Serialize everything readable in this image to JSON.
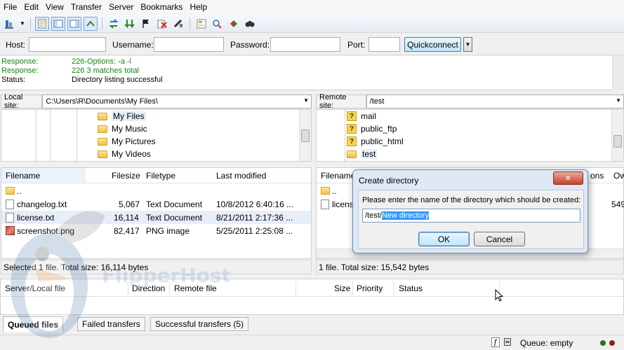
{
  "menu": [
    "File",
    "Edit",
    "View",
    "Transfer",
    "Server",
    "Bookmarks",
    "Help"
  ],
  "toolbar": {
    "icons": [
      "site-manager-icon",
      "dropdown-icon",
      "toggle-log-icon",
      "toggle-tree-icon",
      "toggle-remote-tree-icon",
      "toggle-queue-icon",
      "refresh-icon",
      "process-queue-icon",
      "cancel-icon",
      "disconnect-icon",
      "reconnect-icon",
      "filter-icon",
      "compare-icon",
      "sync-browse-icon",
      "search-icon"
    ]
  },
  "quickconnect": {
    "host_label": "Host:",
    "username_label": "Username:",
    "password_label": "Password:",
    "port_label": "Port:",
    "button_label": "Quickconnect"
  },
  "log": [
    {
      "key": "Response:",
      "value": "226-Options: -a -l",
      "color": "#118811"
    },
    {
      "key": "Response:",
      "value": "226 3 matches total",
      "color": "#118811"
    },
    {
      "key": "Status:",
      "value": "Directory listing successful",
      "color": "#000000"
    }
  ],
  "local": {
    "site_label": "Local site:",
    "path": "C:\\Users\\R\\Documents\\My Files\\",
    "tree": [
      "My Files",
      "My Music",
      "My Pictures",
      "My Videos"
    ],
    "columns": [
      "Filename",
      "Filesize",
      "Filetype",
      "Last modified"
    ],
    "rows": [
      {
        "name": "..",
        "size": "",
        "type": "",
        "modified": ""
      },
      {
        "name": "changelog.txt",
        "size": "5,067",
        "type": "Text Document",
        "modified": "10/8/2012 6:40:16 ..."
      },
      {
        "name": "license.txt",
        "size": "16,114",
        "type": "Text Document",
        "modified": "8/21/2011 2:17:36 ..."
      },
      {
        "name": "screenshot.png",
        "size": "82,417",
        "type": "PNG image",
        "modified": "5/25/2011 2:25:08 ..."
      }
    ],
    "status": "Selected 1 file. Total size: 16,114 bytes"
  },
  "remote": {
    "site_label": "Remote site:",
    "path": "/test",
    "tree": [
      "mail",
      "public_ftp",
      "public_html",
      "test"
    ],
    "columns": [
      "Filename",
      "ons",
      "Ow"
    ],
    "rows": [
      {
        "name": "..",
        "size": ""
      },
      {
        "name": "licens",
        "size": "549"
      }
    ],
    "status": "1 file. Total size: 15,542 bytes"
  },
  "queue": {
    "columns": [
      "Server/Local file",
      "Direction",
      "Remote file",
      "Size",
      "Priority",
      "Status"
    ],
    "tabs": [
      "Queued files",
      "Failed transfers",
      "Successful transfers (5)"
    ]
  },
  "statusbar": {
    "queue_text": "Queue: empty"
  },
  "dialog": {
    "title": "Create directory",
    "prompt": "Please enter the name of the directory which should be created:",
    "input_prefix": "/test/",
    "input_selected": "New directory",
    "ok_label": "OK",
    "cancel_label": "Cancel"
  },
  "watermark": "FlipperHost"
}
